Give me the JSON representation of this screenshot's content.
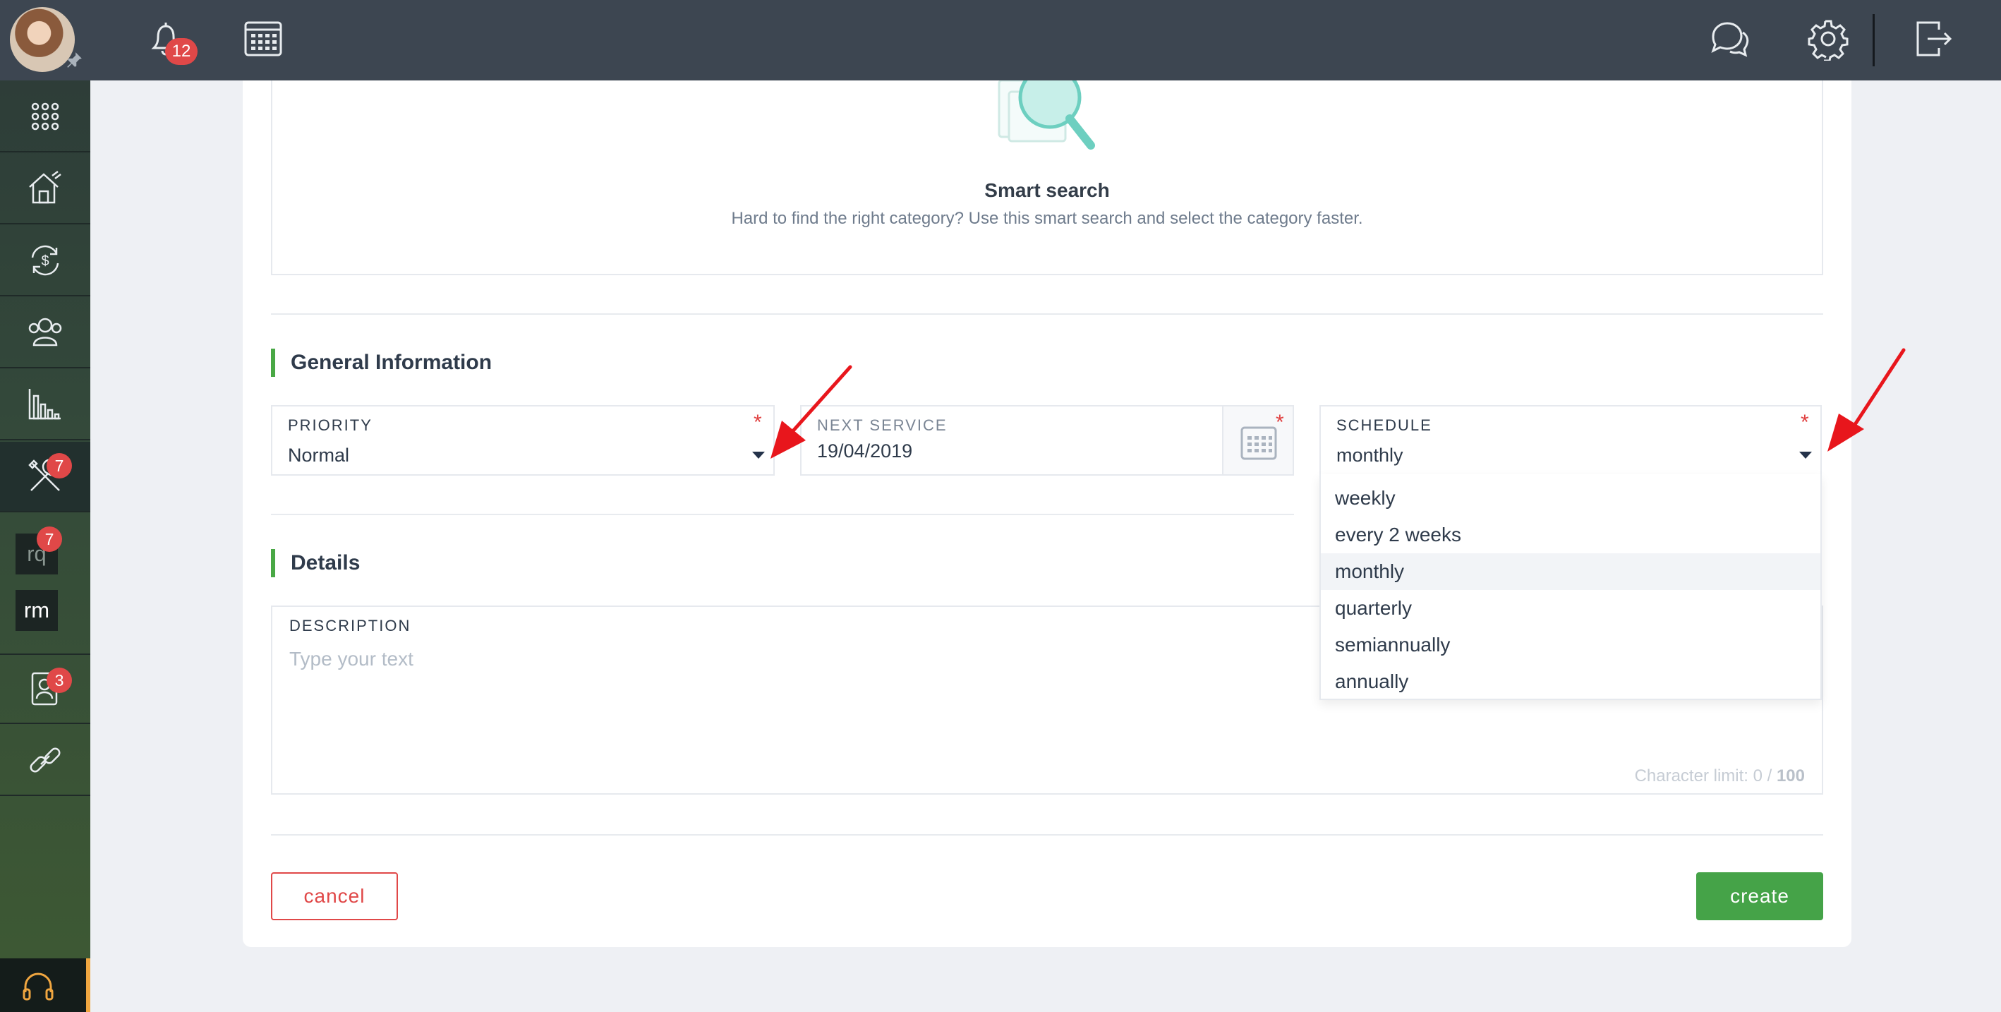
{
  "sidebar": {
    "badges": {
      "maintenance": "7",
      "rq": "7",
      "tenants": "3"
    },
    "text_items": {
      "rq": "rq",
      "rm": "rm"
    }
  },
  "topbar": {
    "notification_count": "12",
    "icons": [
      "bell-icon",
      "calendar-icon",
      "chat-icon",
      "gear-icon",
      "logout-icon"
    ]
  },
  "smart_search": {
    "title": "Smart search",
    "subtitle": "Hard to find the right category? Use this smart search and select the category faster."
  },
  "general_information": {
    "title": "General Information",
    "priority": {
      "label": "PRIORITY",
      "value": "Normal",
      "required_mark": "*"
    },
    "next_service": {
      "label": "NEXT SERVICE",
      "value": "19/04/2019",
      "required_mark": "*"
    },
    "schedule": {
      "label": "SCHEDULE",
      "value": "monthly",
      "required_mark": "*",
      "options": [
        "weekly",
        "every 2 weeks",
        "monthly",
        "quarterly",
        "semiannually",
        "annually"
      ],
      "selected_index": 2
    }
  },
  "details": {
    "title": "Details",
    "description": {
      "label": "DESCRIPTION",
      "placeholder": "Type your text",
      "char_limit_prefix": "Character limit: 0 / ",
      "char_limit_max": "100"
    }
  },
  "actions": {
    "cancel": "cancel",
    "create": "create"
  },
  "colors": {
    "accent_green": "#45a348",
    "danger_red": "#e04848",
    "topbar": "#3d4651",
    "annotation_arrow": "#e8161c"
  }
}
